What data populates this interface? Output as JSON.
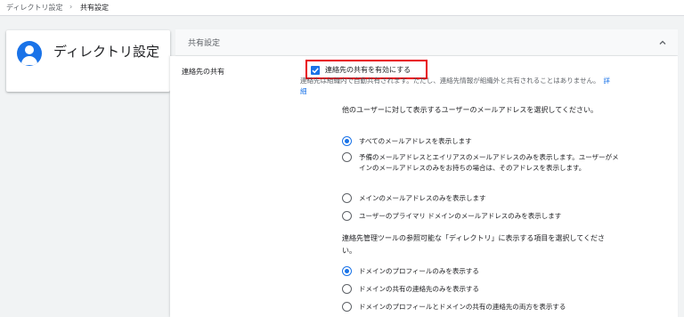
{
  "breadcrumb": {
    "root": "ディレクトリ設定",
    "separator": "›",
    "current": "共有設定"
  },
  "sidebar": {
    "icon": "account-circle-icon",
    "title": "ディレクトリ設定"
  },
  "panel": {
    "title": "共有設定",
    "collapse_icon": "chevron-up-icon"
  },
  "contact_sharing": {
    "row_label": "連絡先の共有",
    "checkbox_label": "連絡先の共有を有効にする",
    "checkbox_checked": true,
    "description": "連絡先は組織内で自動共有されます。ただし、連絡先情報が組織外と共有されることはありません。",
    "details_link": "詳細"
  },
  "email_question": "他のユーザーに対して表示するユーザーのメールアドレスを選択してください。",
  "email_options": [
    {
      "label": "すべてのメールアドレスを表示します",
      "selected": true
    },
    {
      "label": "予備のメールアドレスとエイリアスのメールアドレスのみを表示します。ユーザーがメインのメールアドレスのみをお持ちの場合は、そのアドレスを表示します。",
      "selected": false
    },
    {
      "label": "メインのメールアドレスのみを表示します",
      "selected": false
    },
    {
      "label": "ユーザーのプライマリ ドメインのメールアドレスのみを表示します",
      "selected": false
    }
  ],
  "directory_question": "連絡先管理ツールの参照可能な「ディレクトリ」に表示する項目を選択してください。",
  "directory_options": [
    {
      "label": "ドメインのプロフィールのみを表示する",
      "selected": true
    },
    {
      "label": "ドメインの共有の連絡先のみを表示する",
      "selected": false
    },
    {
      "label": "ドメインのプロフィールとドメインの共有の連絡先の両方を表示する",
      "selected": false
    }
  ],
  "colors": {
    "accent": "#1a73e8",
    "highlight": "#e8000d"
  }
}
